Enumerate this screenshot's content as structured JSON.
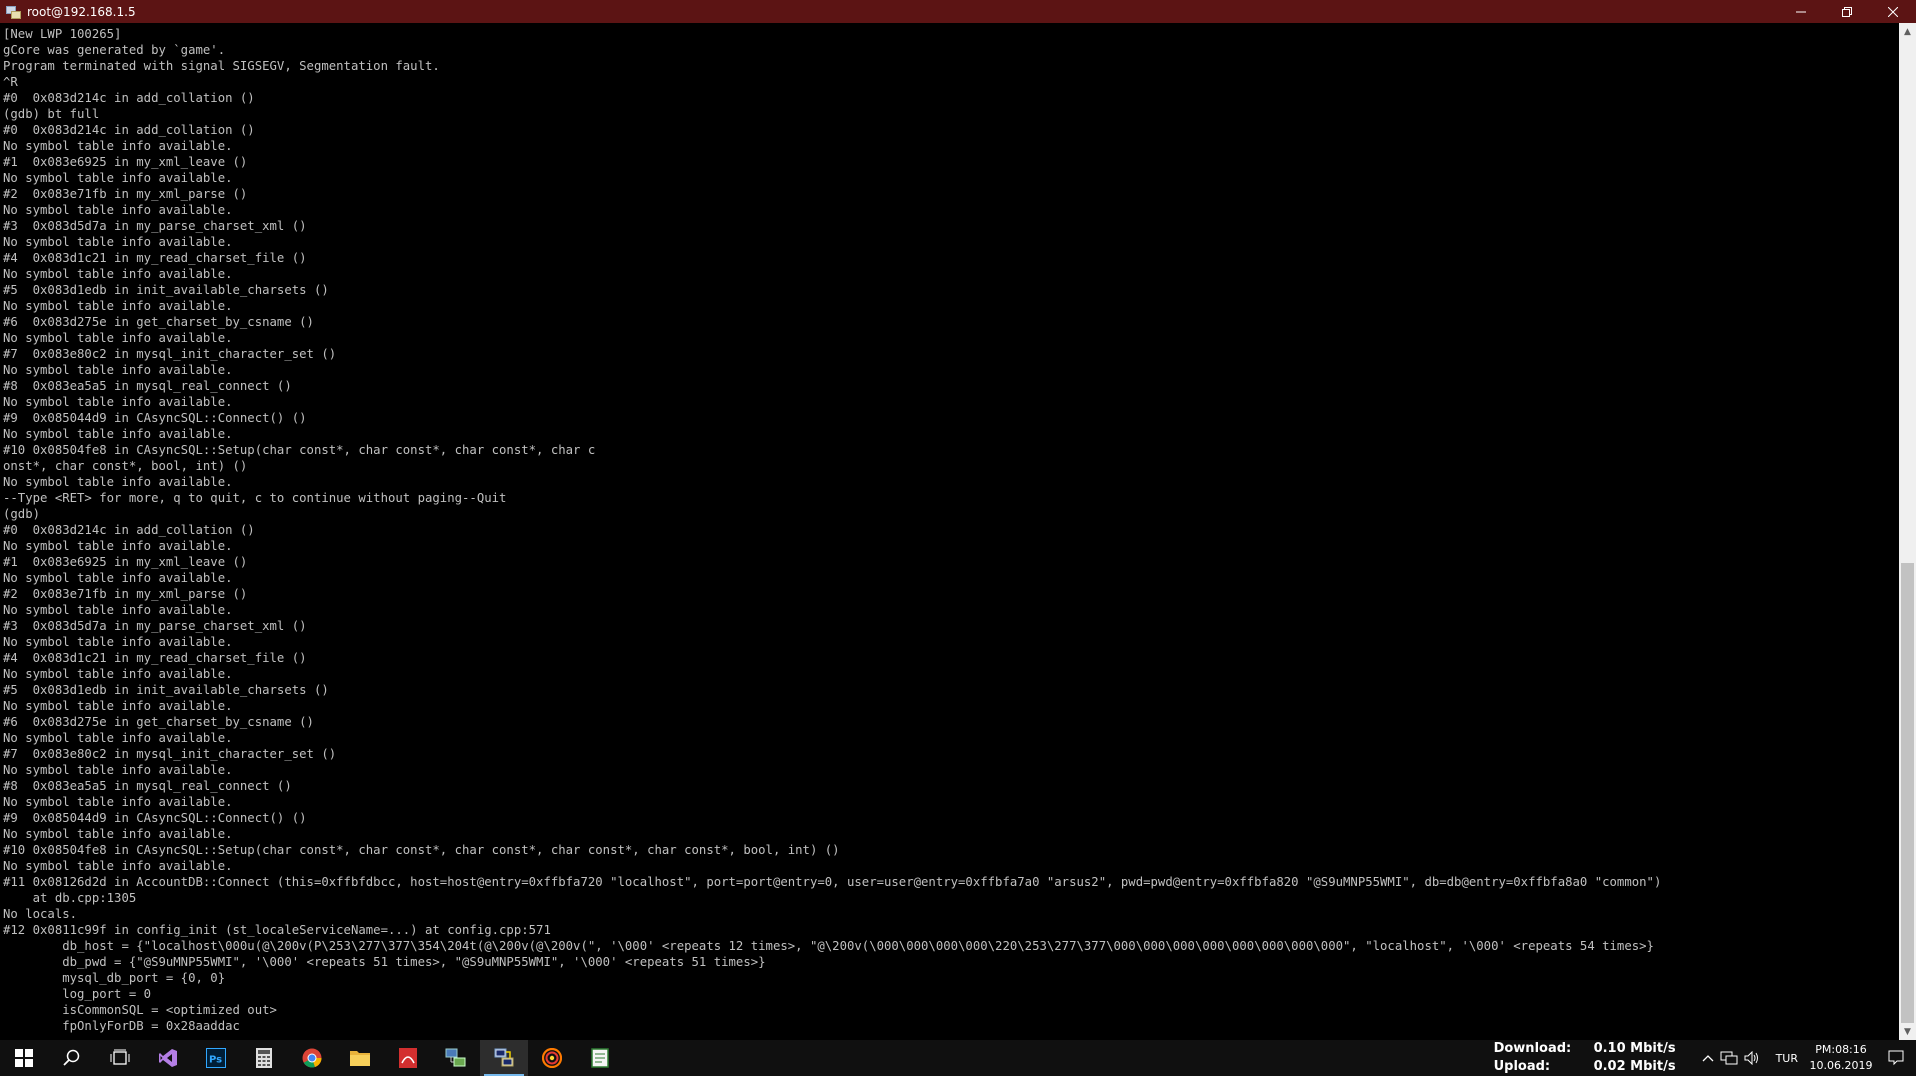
{
  "window": {
    "title": "root@192.168.1.5"
  },
  "terminal": {
    "lines": [
      "[New LWP 100265]",
      "gCore was generated by `game'.",
      "Program terminated with signal SIGSEGV, Segmentation fault.",
      "^R",
      "#0  0x083d214c in add_collation ()",
      "(gdb) bt full",
      "#0  0x083d214c in add_collation ()",
      "No symbol table info available.",
      "#1  0x083e6925 in my_xml_leave ()",
      "No symbol table info available.",
      "#2  0x083e71fb in my_xml_parse ()",
      "No symbol table info available.",
      "#3  0x083d5d7a in my_parse_charset_xml ()",
      "No symbol table info available.",
      "#4  0x083d1c21 in my_read_charset_file ()",
      "No symbol table info available.",
      "#5  0x083d1edb in init_available_charsets ()",
      "No symbol table info available.",
      "#6  0x083d275e in get_charset_by_csname ()",
      "No symbol table info available.",
      "#7  0x083e80c2 in mysql_init_character_set ()",
      "No symbol table info available.",
      "#8  0x083ea5a5 in mysql_real_connect ()",
      "No symbol table info available.",
      "#9  0x085044d9 in CAsyncSQL::Connect() ()",
      "No symbol table info available.",
      "#10 0x08504fe8 in CAsyncSQL::Setup(char const*, char const*, char const*, char c",
      "onst*, char const*, bool, int) ()",
      "No symbol table info available.",
      "--Type <RET> for more, q to quit, c to continue without paging--Quit",
      "(gdb)",
      "#0  0x083d214c in add_collation ()",
      "No symbol table info available.",
      "#1  0x083e6925 in my_xml_leave ()",
      "No symbol table info available.",
      "#2  0x083e71fb in my_xml_parse ()",
      "No symbol table info available.",
      "#3  0x083d5d7a in my_parse_charset_xml ()",
      "No symbol table info available.",
      "#4  0x083d1c21 in my_read_charset_file ()",
      "No symbol table info available.",
      "#5  0x083d1edb in init_available_charsets ()",
      "No symbol table info available.",
      "#6  0x083d275e in get_charset_by_csname ()",
      "No symbol table info available.",
      "#7  0x083e80c2 in mysql_init_character_set ()",
      "No symbol table info available.",
      "#8  0x083ea5a5 in mysql_real_connect ()",
      "No symbol table info available.",
      "#9  0x085044d9 in CAsyncSQL::Connect() ()",
      "No symbol table info available.",
      "#10 0x08504fe8 in CAsyncSQL::Setup(char const*, char const*, char const*, char const*, char const*, bool, int) ()",
      "No symbol table info available.",
      "#11 0x08126d2d in AccountDB::Connect (this=0xffbfdbcc, host=host@entry=0xffbfa720 \"localhost\", port=port@entry=0, user=user@entry=0xffbfa7a0 \"arsus2\", pwd=pwd@entry=0xffbfa820 \"@S9uMNP55WMI\", db=db@entry=0xffbfa8a0 \"common\")",
      "    at db.cpp:1305",
      "No locals.",
      "#12 0x0811c99f in config_init (st_localeServiceName=...) at config.cpp:571",
      "        db_host = {\"localhost\\000u(@\\200v(P\\253\\277\\377\\354\\204t(@\\200v(@\\200v(\", '\\000' <repeats 12 times>, \"@\\200v(\\000\\000\\000\\000\\220\\253\\277\\377\\000\\000\\000\\000\\000\\000\\000\\000\", \"localhost\", '\\000' <repeats 54 times>}",
      "        db_pwd = {\"@S9uMNP55WMI\", '\\000' <repeats 51 times>, \"@S9uMNP55WMI\", '\\000' <repeats 51 times>}",
      "        mysql_db_port = {0, 0}",
      "        log_port = 0",
      "        isCommonSQL = <optimized out>",
      "        fpOnlyForDB = 0x28aaddac"
    ]
  },
  "taskbar": {
    "network": {
      "download_label": "Download:",
      "download_value": "0.10 Mbit/s",
      "upload_label": "Upload:",
      "upload_value": "0.02 Mbit/s"
    },
    "language": "TUR",
    "time": "PM:08:16",
    "date": "10.06.2019"
  },
  "colors": {
    "titlebar": "#5c1414",
    "terminal_bg": "#000000",
    "terminal_fg": "#c0c0c0",
    "taskbar": "#101010"
  }
}
